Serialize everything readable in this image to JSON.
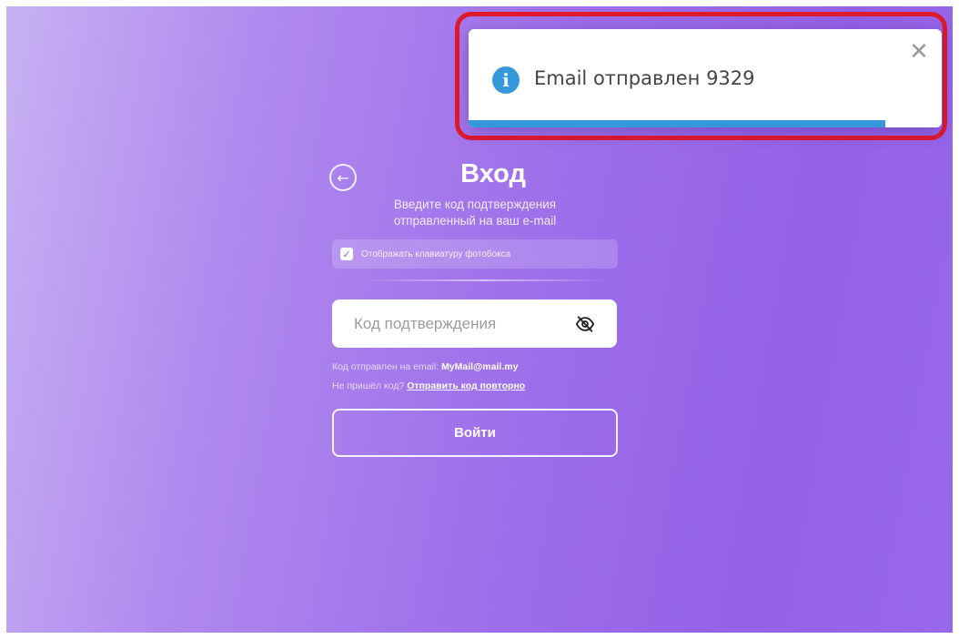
{
  "toast": {
    "message": "Email отправлен 9329",
    "info_icon_glyph": "i",
    "close_glyph": "✕",
    "progress": 0.88,
    "accent_color": "#3498db",
    "highlight_color": "#e0192b"
  },
  "login": {
    "back_glyph": "←",
    "title": "Вход",
    "subtitle_line1": "Введите код подтверждения",
    "subtitle_line2": "отправленный на ваш e-mail",
    "keyboard_checkbox_glyph": "✓",
    "keyboard_label": "Отображать клавиатуру фотобокса",
    "keyboard_checked": true,
    "code_placeholder": "Код подтверждения",
    "code_value": "",
    "sent_to_prefix": "Код отправлен на email: ",
    "sent_to_email": "MyMail@mail.my",
    "not_received_prefix": "Не пришёл код? ",
    "resend_label": "Отправить код повторно",
    "submit_label": "Войти"
  },
  "icons": {
    "toast_icon": "info-icon",
    "toast_close": "close-icon",
    "back": "arrow-left-icon",
    "checkbox": "checkmark-icon",
    "code_visibility": "eye-off-icon"
  }
}
